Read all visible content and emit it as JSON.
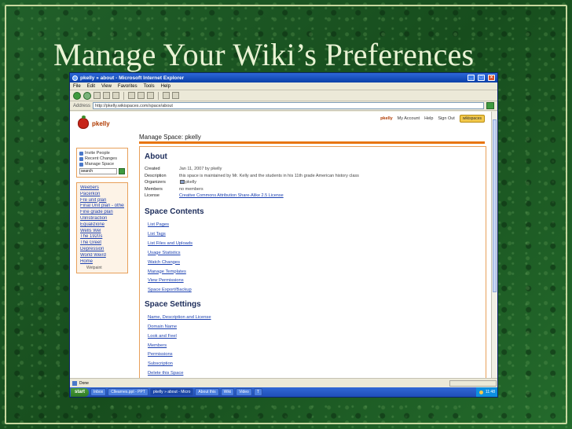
{
  "slide": {
    "title": "Manage Your Wiki’s Preferences"
  },
  "browser": {
    "window_title": "pkelly » about - Microsoft Internet Explorer",
    "menu": [
      "File",
      "Edit",
      "View",
      "Favorites",
      "Tools",
      "Help"
    ],
    "address_label": "Address",
    "address_url": "http://pkelly.wikispaces.com/space/about",
    "status_text": "Done"
  },
  "page": {
    "space_name": "pkelly",
    "top_links": {
      "user": "pkelly",
      "my_account": "My Account",
      "help": "Help",
      "sign_out": "Sign Out",
      "wetpaint": "wikispaces"
    },
    "manage_heading": "Manage Space: pkelly",
    "sidebar": {
      "tools": [
        "Invite People",
        "Recent Changes",
        "Manage Space"
      ],
      "search_value": "search",
      "nav_items": [
        "Weebers",
        "Pacerkon",
        "Fre unit plan",
        "Final Unit plan - other",
        "Fine grade plan",
        "Ulinstiraction",
        "Equalizione",
        "Wells Wel",
        "The 1920s",
        "The Greet",
        "Depression",
        "World Weird",
        "Home"
      ],
      "powered_by": "Wetpaint"
    },
    "about": {
      "title": "About",
      "rows": [
        {
          "k": "Created",
          "v": "Jan 11, 2007 by pkelly"
        },
        {
          "k": "Description",
          "v": "this space is maintained by Mr. Kelly and the students in his 11th grade American history class"
        },
        {
          "k": "Organizers",
          "v": "pkelly"
        },
        {
          "k": "Members",
          "v": "no members"
        },
        {
          "k": "License",
          "v": "Creative Commons Attribution Share-Alike 2.5 License"
        }
      ]
    },
    "contents": {
      "title": "Space Contents",
      "links": [
        "List Pages",
        "List Tags",
        "List Files and Uploads",
        "Usage Statistics",
        "Watch Changes",
        "Manage Templates",
        "View Permissions",
        "Space Export/Backup"
      ]
    },
    "settings": {
      "title": "Space Settings",
      "links": [
        "Name, Description and License",
        "Domain Name",
        "Look and Feel",
        "Members",
        "Permissions",
        "Subscription",
        "Delete this Space"
      ]
    }
  },
  "taskbar": {
    "start": "start",
    "tasks": [
      "Inbox",
      "Cllearnes.ppt - PPT",
      "pkelly » about - Micro",
      "About this",
      "Wiki",
      "Video",
      "T"
    ],
    "clock": "11:48"
  }
}
